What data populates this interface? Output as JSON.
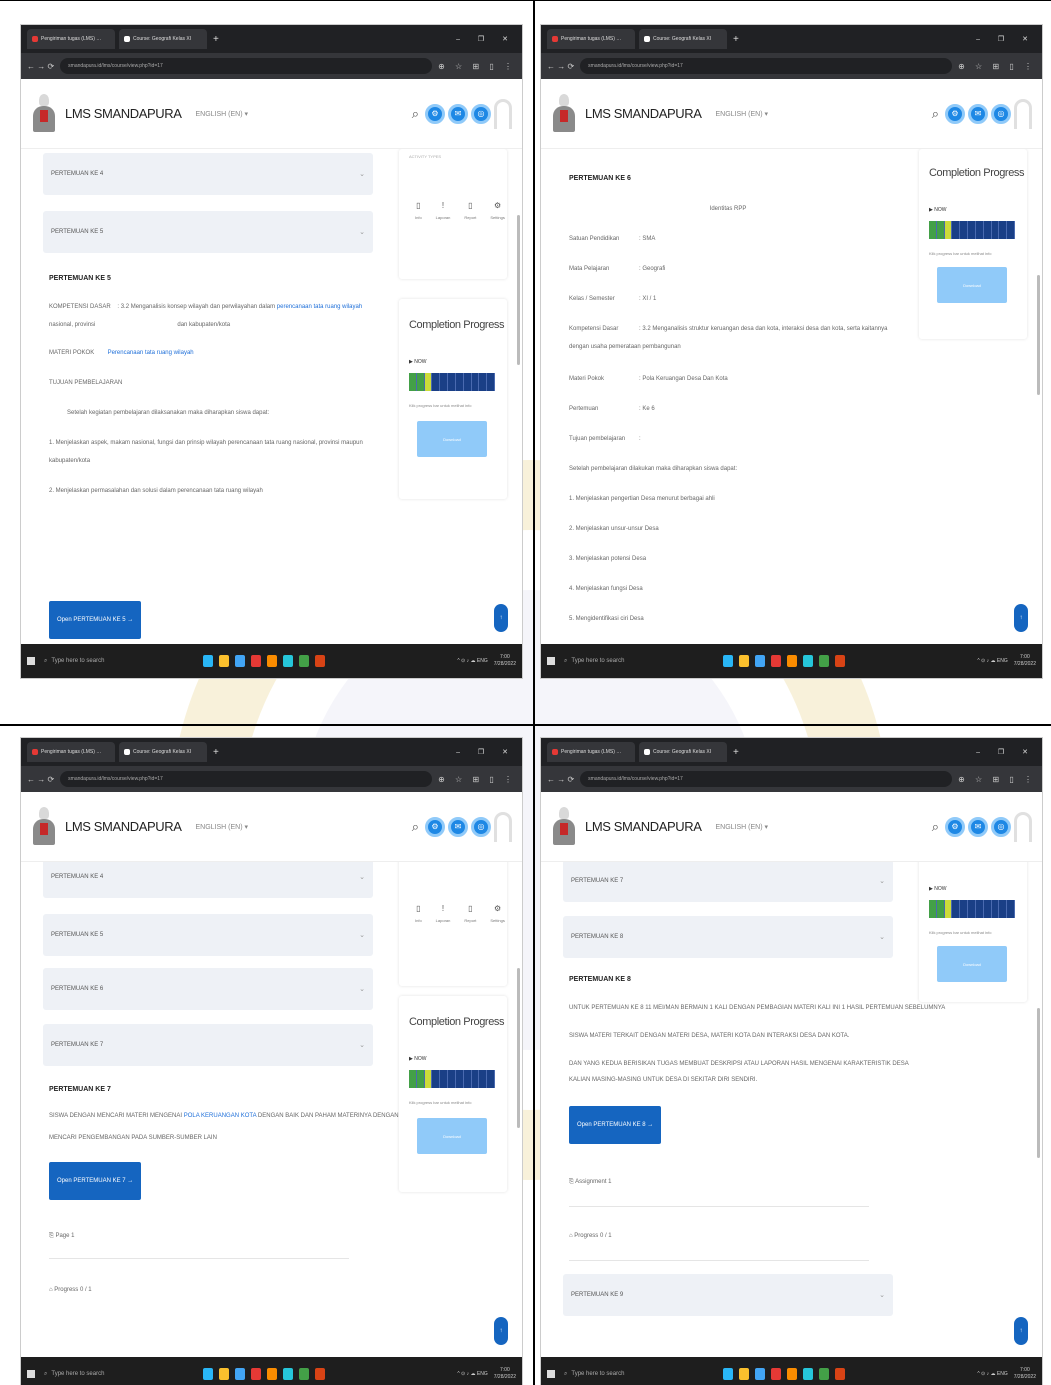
{
  "browser": {
    "tab1": "Pengiriman tugas (LMS) …",
    "tab2": "Course: Geografi Kelas XI",
    "new_tab": "+",
    "window_controls": "–  ❐  ✕",
    "url": "smandapura.id/lms/course/view.php?id=17",
    "ext": "⊕ ☆ ⊞ ▯ ⋮"
  },
  "app": {
    "brand": "LMS SMANDAPURA",
    "language": "ENGLISH (EN) ▾",
    "search_icon": "⌕",
    "icons": [
      "⚙",
      "✉",
      "◎"
    ]
  },
  "sidebar": {
    "completion_title": "Completion Progress",
    "now_label": "▶ NOW",
    "progress_note": "Klik progress bar untuk melihat info",
    "download_button": "Download",
    "activity_icons": [
      {
        "glyph": "▯",
        "label": "Info"
      },
      {
        "glyph": "!",
        "label": "Laporan"
      },
      {
        "glyph": "▯",
        "label": "Report"
      },
      {
        "glyph": "⚙",
        "label": "Settings"
      }
    ],
    "blocks_header": "ACTIVITY TYPES"
  },
  "taskbar": {
    "search": "Type here to search",
    "tray": "^ ⊙ ♪ ☁ ENG",
    "time": "7:00",
    "date": "7/28/2022"
  },
  "panel1": {
    "acc1": "PERTEMUAN KE 4",
    "acc2": "PERTEMUAN KE 5",
    "title": "PERTEMUAN KE 5",
    "kd_label": "KOMPETENSI DASAR",
    "kd_text": ": 3.2 Menganalisis konsep wilayah dan perwilayahan dalam",
    "kd_link": "perencanaan tata ruang wilayah",
    "kd_cont1": "nasional, provinsi",
    "kd_cont2": "dan kabupaten/kota",
    "materi_label": "MATERI POKOK",
    "materi_link": "Perencanaan tata ruang wilayah",
    "tujuan": "TUJUAN PEMBELAJARAN",
    "intro": "Setelah kegiatan pembelajaran dilaksanakan maka diharapkan siswa dapat:",
    "item1": "1.  Menjelaskan aspek, makam nasional, fungsi dan prinsip wilayah perencanaan tata ruang nasional, provinsi maupun",
    "item1b": "kabupaten/kota",
    "item2": "2.  Menjelaskan permasalahan dan solusi dalam perencanaan tata ruang wilayah",
    "open_button": "Open PERTEMUAN KE 5  →"
  },
  "panel2": {
    "title": "PERTEMUAN KE 6",
    "center": "Identitas RPP",
    "rows": [
      {
        "k": "Satuan Pendidikan",
        "v": ": SMA"
      },
      {
        "k": "Mata Pelajaran",
        "v": ": Geografi"
      },
      {
        "k": "Kelas / Semester",
        "v": ": XI / 1"
      },
      {
        "k": "Kompetensi Dasar",
        "v": ": 3.2 Menganalisis struktur keruangan desa dan kota, interaksi desa dan kota, serta kaitannya"
      },
      {
        "k": "",
        "v": "dengan usaha pemerataan pembangunan"
      },
      {
        "k": "Materi Pokok",
        "v": ": Pola Keruangan Desa Dan Kota"
      },
      {
        "k": "Pertemuan",
        "v": ": Ke 6"
      },
      {
        "k": "Tujuan pembelajaran",
        "v": ":"
      }
    ],
    "intro": "Setelah pembelajaran dilakukan maka diharapkan siswa dapat:",
    "items": [
      "1.  Menjelaskan pengertian Desa menurut berbagai ahli",
      "2.  Menjelaskan unsur-unsur Desa",
      "3.  Menjelaskan potensi Desa",
      "4.  Menjelaskan fungsi Desa",
      "5.  Mengidentifikasi ciri Desa"
    ]
  },
  "panel3": {
    "acc": [
      "PERTEMUAN KE 4",
      "PERTEMUAN KE 5",
      "PERTEMUAN KE 6",
      "PERTEMUAN KE 7"
    ],
    "title": "PERTEMUAN KE 7",
    "line1a": "SISWA DENGAN MENCARI MATERI MENGENAI ",
    "line1link": "POLA KERUANGAN KOTA",
    "line1b": " DENGAN BAIK DAN PAHAM MATERINYA DENGAN",
    "line2": "MENCARI PENGEMBANGAN PADA SUMBER-SUMBER LAIN",
    "open_button": "Open PERTEMUAN KE 7  →",
    "page": "⎘  Page 1",
    "progress": "⌂  Progress 0 / 1"
  },
  "panel4": {
    "acc1": "PERTEMUAN KE 7",
    "acc2": "PERTEMUAN KE 8",
    "title": "PERTEMUAN KE 8",
    "line1": "UNTUK PERTEMUAN KE 8 11 MEI/MAN BERMAIN 1 KALI DENGAN PEMBAGIAN MATERI KALI INI 1 HASIL PERTEMUAN SEBELUMNYA",
    "line2": "SISWA MATERI TERKAIT DENGAN MATERI DESA, MATERI KOTA DAN INTERAKSI DESA DAN KOTA.",
    "line3": "DAN YANG KEDUA BERISIKAN TUGAS MEMBUAT DESKRIPSI ATAU LAPORAN HASIL MENGENAI KARAKTERISTIK DESA",
    "line4": "KALIAN MASING-MASING UNTUK DESA DI SEKITAR DIRI SENDIRI.",
    "open_button": "Open PERTEMUAN KE 8  →",
    "assignment": "⎘  Assignment 1",
    "progress": "⌂  Progress 0 / 1",
    "acc3": "PERTEMUAN KE 9"
  },
  "chevron": "⌄",
  "fab": "↑"
}
